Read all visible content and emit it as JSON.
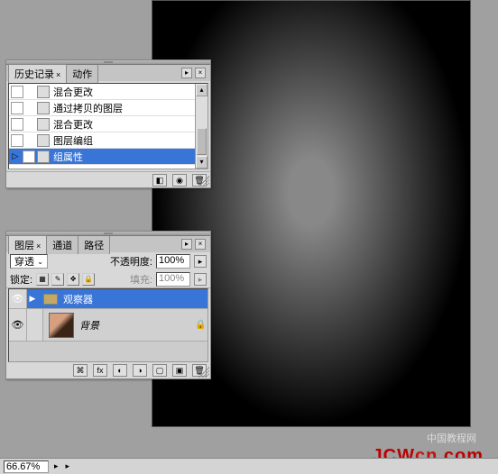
{
  "history_panel": {
    "tabs": [
      {
        "label": "历史记录",
        "active": true
      },
      {
        "label": "动作",
        "active": false
      }
    ],
    "items": [
      {
        "label": "混合更改",
        "selected": false
      },
      {
        "label": "通过拷贝的图层",
        "selected": false
      },
      {
        "label": "混合更改",
        "selected": false
      },
      {
        "label": "图层编组",
        "selected": false
      },
      {
        "label": "组属性",
        "selected": true
      }
    ]
  },
  "layers_panel": {
    "tabs": [
      {
        "label": "图层",
        "active": true
      },
      {
        "label": "通道",
        "active": false
      },
      {
        "label": "路径",
        "active": false
      }
    ],
    "blend_label": "穿透",
    "opacity_label": "不透明度:",
    "opacity_value": "100%",
    "lock_label": "锁定:",
    "fill_label": "填充:",
    "fill_value": "100%",
    "layers": [
      {
        "name": "观察器",
        "type": "group",
        "selected": true,
        "visible": true
      },
      {
        "name": "背景",
        "type": "layer",
        "selected": false,
        "visible": true,
        "locked": true
      }
    ]
  },
  "status": {
    "zoom": "66.67%"
  },
  "watermark": {
    "site": "JCWcn.com",
    "cn": "中国教程网"
  }
}
